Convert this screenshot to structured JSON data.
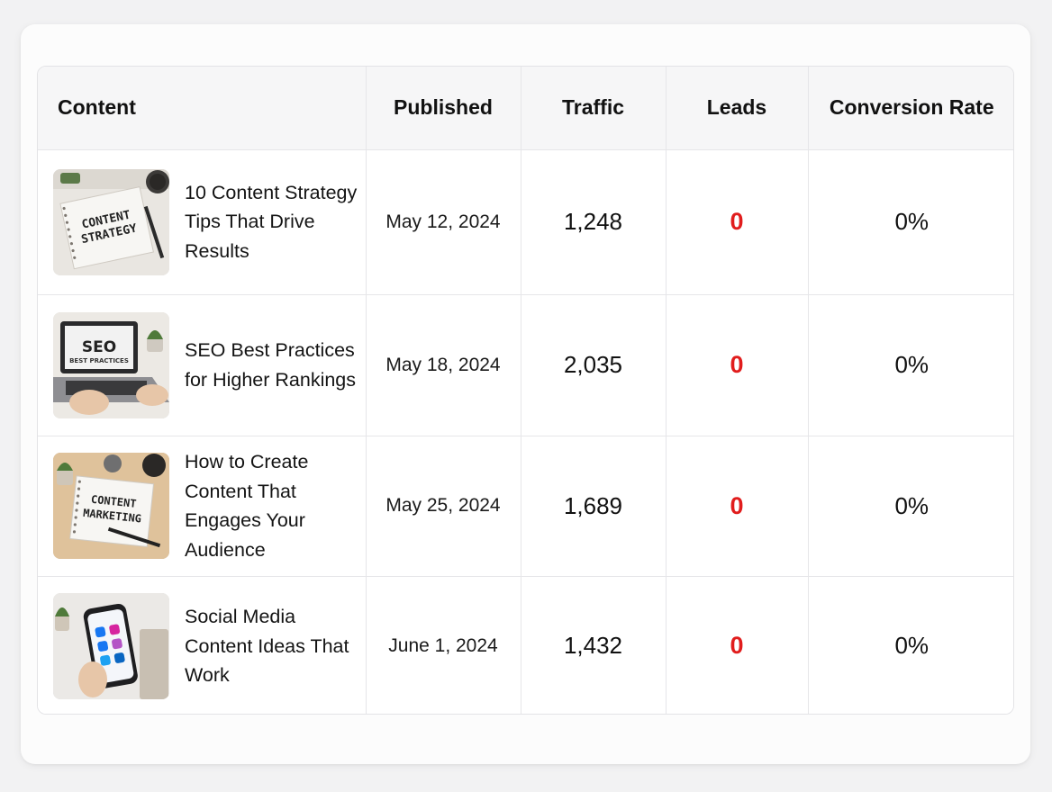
{
  "table": {
    "headers": {
      "content": "Content",
      "published": "Published",
      "traffic": "Traffic",
      "leads": "Leads",
      "conversion_rate": "Conversion Rate"
    },
    "rows": [
      {
        "title": "10 Content Strategy Tips That Drive Results",
        "thumbnail_text": [
          "CONTENT",
          "STRATEGY"
        ],
        "published": "May 12, 2024",
        "traffic": "1,248",
        "leads": "0",
        "conversion_rate": "0%"
      },
      {
        "title": "SEO Best Practices for Higher Rankings",
        "thumbnail_text": [
          "SEO",
          "BEST PRACTICES"
        ],
        "published": "May 18, 2024",
        "traffic": "2,035",
        "leads": "0",
        "conversion_rate": "0%"
      },
      {
        "title": "How to Create Content That Engages Your Audience",
        "thumbnail_text": [
          "CONTENT",
          "MARKETING"
        ],
        "published": "May 25, 2024",
        "traffic": "1,689",
        "leads": "0",
        "conversion_rate": "0%"
      },
      {
        "title": "Social Media Content Ideas That Work",
        "thumbnail_text": [],
        "published": "June 1, 2024",
        "traffic": "1,432",
        "leads": "0",
        "conversion_rate": "0%"
      }
    ]
  },
  "colors": {
    "leads_zero": "#e11d1d",
    "header_bg": "#f6f6f7",
    "border": "#e6e6e9"
  }
}
